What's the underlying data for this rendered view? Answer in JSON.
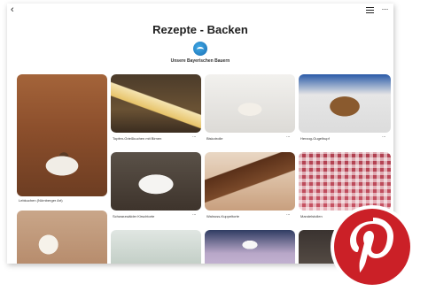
{
  "header": {
    "back_glyph": "‹",
    "title": "Rezepte - Backen",
    "subtitle": "Unsere Bayerischen Bauern",
    "more_glyph": "···"
  },
  "pins": [
    {
      "caption": "Lebkuchen (Nürnberger Art)"
    },
    {
      "caption": "Topfen-Grießkuchen mit Birnen"
    },
    {
      "caption": "Biskotrolle"
    },
    {
      "caption": "Herzog-Gugelhupf"
    },
    {
      "caption": "Schwarzwälder Kirschtorte"
    },
    {
      "caption": "Walnuss-Kuppeltorte"
    },
    {
      "caption": "Mandelstollen"
    }
  ],
  "pin_more_glyph": "···",
  "colors": {
    "brand_red": "#cb2027",
    "avatar_blue": "#1b6fb3"
  },
  "icons": [
    "back-icon",
    "filter-icon",
    "more-icon",
    "board-avatar",
    "pinterest-logo-icon"
  ]
}
